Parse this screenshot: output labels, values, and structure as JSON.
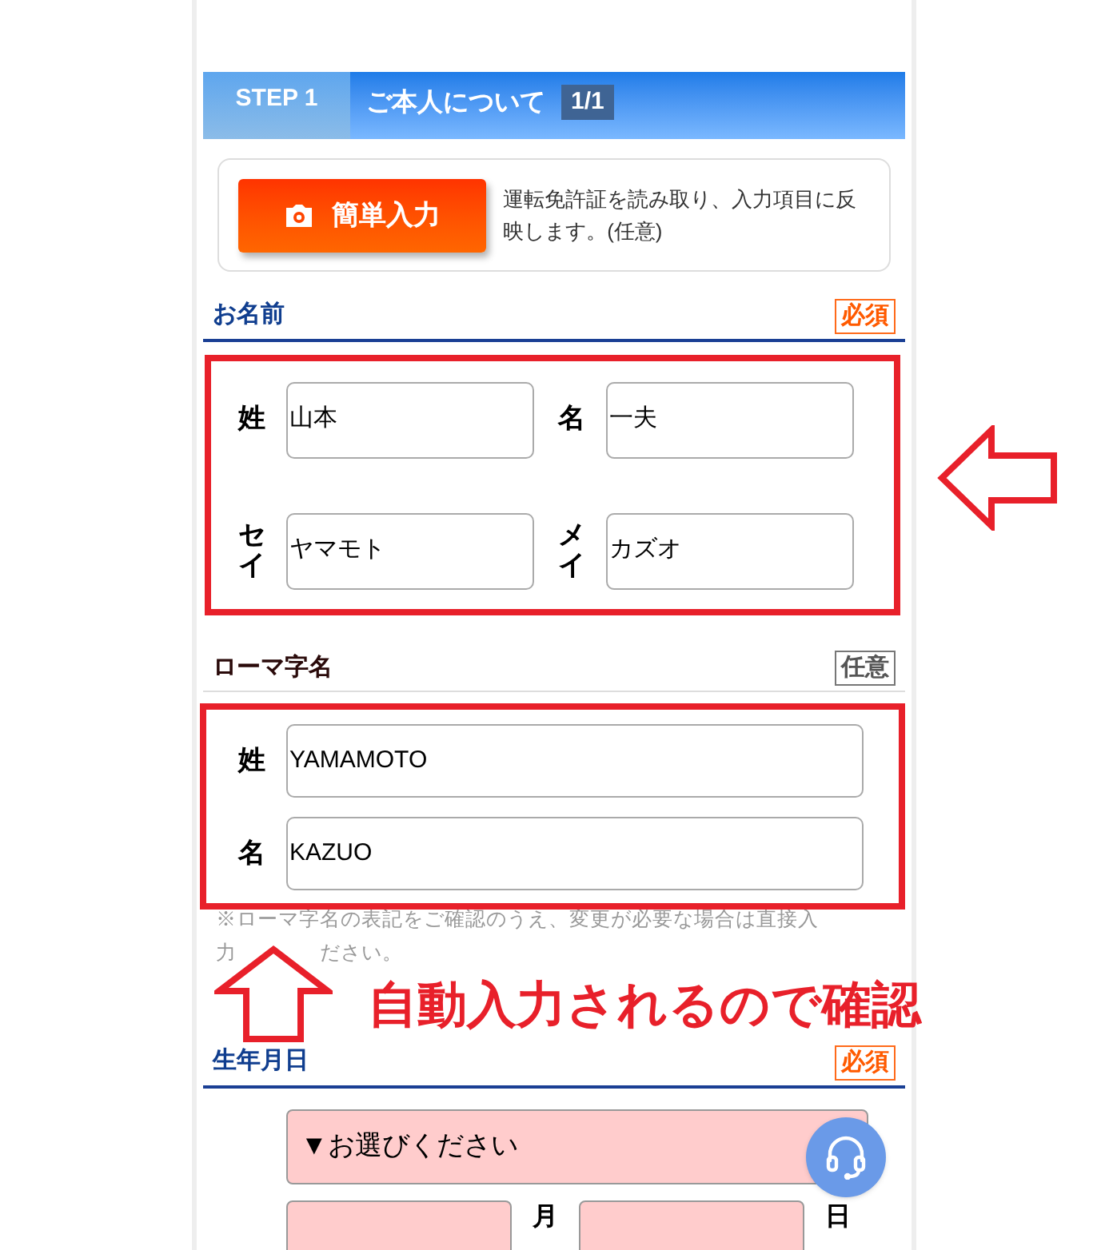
{
  "step": {
    "badge": "STEP 1",
    "title": "ご本人について",
    "page": "1/1"
  },
  "quick_input": {
    "button": "簡単入力",
    "description": "運転免許証を読み取り、入力項目に反映します。(任意)"
  },
  "name_section": {
    "title": "お名前",
    "badge": {
      "label": "必須",
      "kind": "required"
    },
    "rows": [
      {
        "fields": [
          {
            "label": "姓",
            "value": "山本"
          },
          {
            "label": "名",
            "value": "一夫"
          }
        ]
      },
      {
        "fields": [
          {
            "label": "セイ",
            "value": "ヤマモト"
          },
          {
            "label": "メイ",
            "value": "カズオ"
          }
        ]
      }
    ]
  },
  "romaji_section": {
    "title": "ローマ字名",
    "badge": {
      "label": "任意",
      "kind": "optional"
    },
    "fields": [
      {
        "label": "姓",
        "value": "YAMAMOTO"
      },
      {
        "label": "名",
        "value": "KAZUO"
      }
    ],
    "note_lines": [
      [
        "※ローマ字名の表記をご確認のうえ、変更が必要な場合は直接入"
      ],
      [
        "力",
        "ださい。"
      ]
    ]
  },
  "birthday_section": {
    "title": "生年月日",
    "badge": {
      "label": "必須",
      "kind": "required"
    },
    "invalid": true,
    "select": "▼お選びください",
    "fields": [
      {
        "label": "月"
      },
      {
        "label": "日"
      }
    ]
  },
  "annotation": {
    "text": "自動入力されるので確認"
  }
}
